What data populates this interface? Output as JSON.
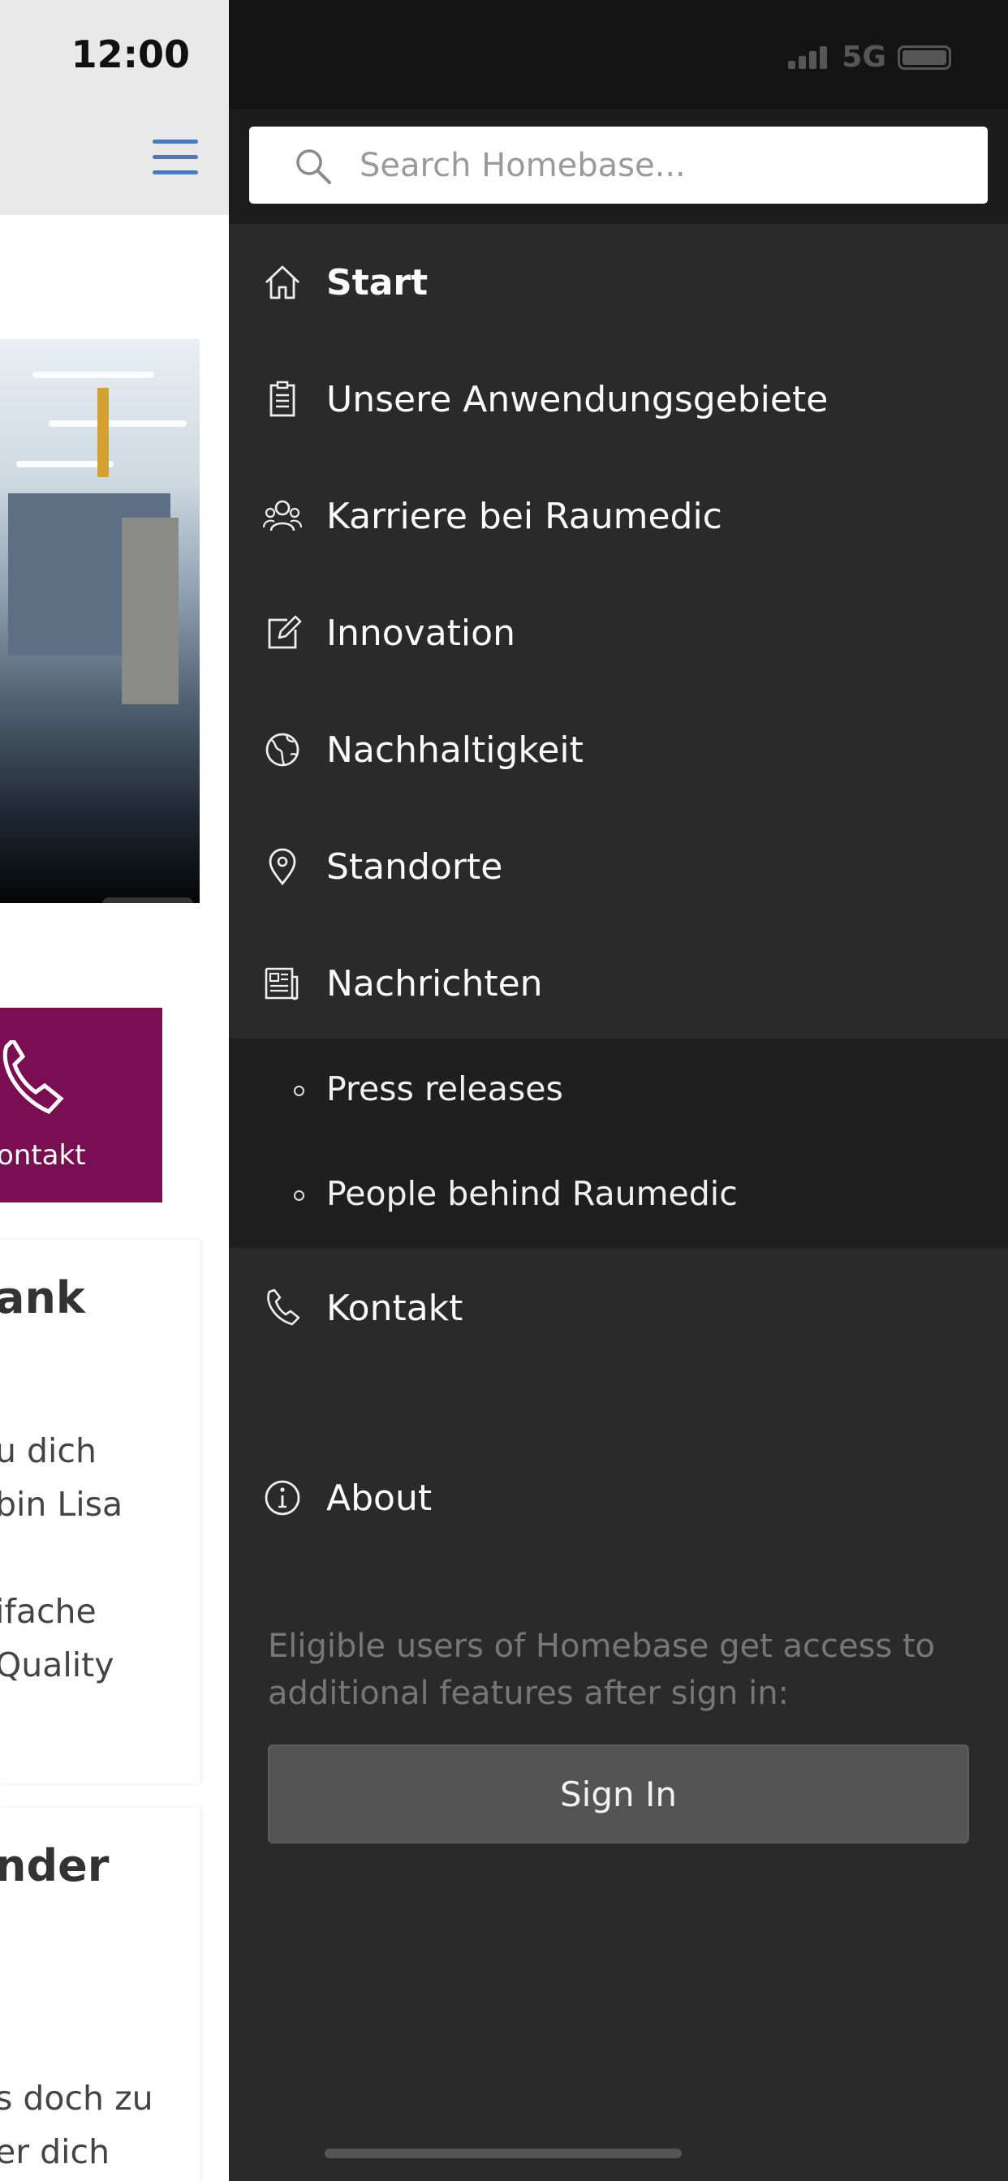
{
  "background_page": {
    "status_time": "12:00",
    "contact_label": "ontakt",
    "cards": [
      {
        "title": "ank",
        "lines": [
          "u dich",
          "bin Lisa",
          "",
          "ifache",
          " Quality"
        ]
      },
      {
        "title": "nder",
        "lines": [
          "s doch zu",
          "er dich"
        ]
      }
    ]
  },
  "status_bar": {
    "network": "5G"
  },
  "search": {
    "placeholder": "Search Homebase..."
  },
  "nav": {
    "items": [
      {
        "label": "Start",
        "icon": "home-icon"
      },
      {
        "label": "Unsere Anwendungsgebiete",
        "icon": "clipboard-icon"
      },
      {
        "label": "Karriere bei Raumedic",
        "icon": "people-icon"
      },
      {
        "label": "Innovation",
        "icon": "edit-icon"
      },
      {
        "label": "Nachhaltigkeit",
        "icon": "globe-icon"
      },
      {
        "label": "Standorte",
        "icon": "location-pin-icon"
      },
      {
        "label": "Nachrichten",
        "icon": "newspaper-icon"
      }
    ],
    "subitems": [
      {
        "label": "Press releases"
      },
      {
        "label": "People behind Raumedic"
      }
    ],
    "contact": {
      "label": "Kontakt",
      "icon": "phone-icon"
    },
    "about": {
      "label": "About",
      "icon": "info-icon"
    }
  },
  "signin": {
    "info": "Eligible users of Homebase get access to additional features after sign in:",
    "button_label": "Sign In"
  },
  "colors": {
    "drawer_bg": "#2a2a2a",
    "submenu_bg": "#1f1f1f",
    "accent_purple": "#7a0e52",
    "hamburger_blue": "#4a78b8"
  }
}
